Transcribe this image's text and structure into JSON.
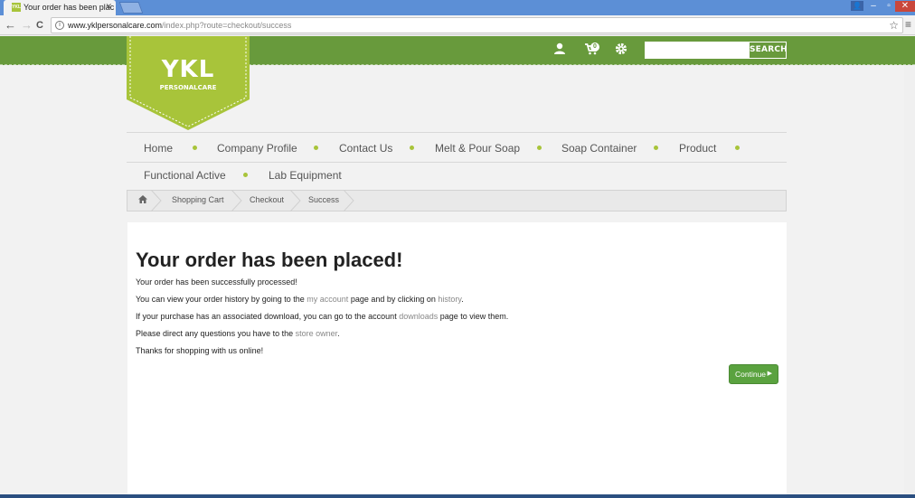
{
  "browser": {
    "tab_title": "Your order has been plac",
    "tab_close": "✕",
    "favicon_text": "YKL",
    "url_host": "www.yklpersonalcare.com",
    "url_path": "/index.php?route=checkout/success",
    "back_icon": "←",
    "forward_icon": "→",
    "reload_icon": "C",
    "star_icon": "☆",
    "menu_icon": "≡",
    "win_min": "–",
    "win_restore": "▫",
    "win_close": "✕"
  },
  "header": {
    "logo_main": "YKL",
    "logo_sub": "PERSONALCARE",
    "cart_count": "0",
    "search_button": "SEARCH",
    "search_placeholder": ""
  },
  "menu": {
    "items": [
      "Home",
      "Company Profile",
      "Contact Us",
      "Melt & Pour Soap",
      "Soap Container",
      "Product",
      "Functional Active",
      "Lab Equipment"
    ]
  },
  "breadcrumb": {
    "home_icon": "home-icon",
    "items": [
      "Shopping Cart",
      "Checkout",
      "Success"
    ]
  },
  "content": {
    "title": "Your order has been placed!",
    "line1": "Your order has been successfully processed!",
    "line2_a": "You can view your order history by going to the ",
    "line2_link1": "my account",
    "line2_b": " page and by clicking on ",
    "line2_link2": "history",
    "line2_c": ".",
    "line3_a": "If your purchase has an associated download, you can go to the account ",
    "line3_link": "downloads",
    "line3_b": " page to view them.",
    "line4_a": "Please direct any questions you have to the ",
    "line4_link": "store owner",
    "line4_b": ".",
    "line5": "Thanks for shopping with us online!",
    "continue_label": "Continue"
  },
  "colors": {
    "brand_green": "#689a3c",
    "logo_green": "#a8c43a",
    "button_green": "#5aa23f"
  }
}
